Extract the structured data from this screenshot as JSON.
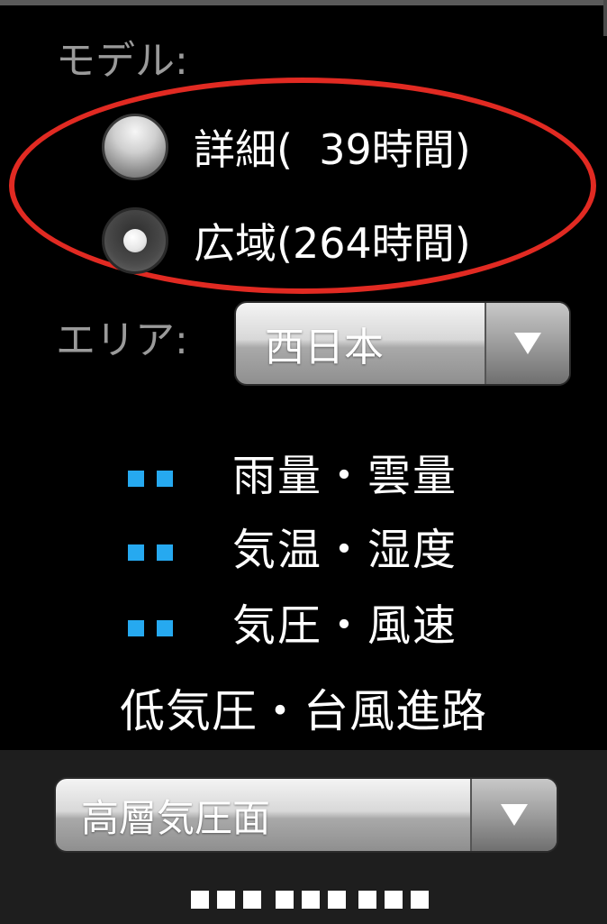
{
  "model": {
    "label": "モデル:",
    "options": [
      {
        "label": "詳細(  39時間)",
        "selected": false
      },
      {
        "label": "広域(264時間)",
        "selected": true
      }
    ]
  },
  "area": {
    "label": "エリア:",
    "selected_value": "西日本"
  },
  "menu": {
    "items": [
      "雨量・雲量",
      "気温・湿度",
      "気圧・風速"
    ],
    "typhoon_track": "低気圧・台風進路"
  },
  "level_select": {
    "selected_value": "高層気圧面"
  },
  "colors": {
    "accent_blue": "#26a9f0",
    "highlight_red": "#e12a22",
    "label_gray": "#9a9a9a"
  }
}
